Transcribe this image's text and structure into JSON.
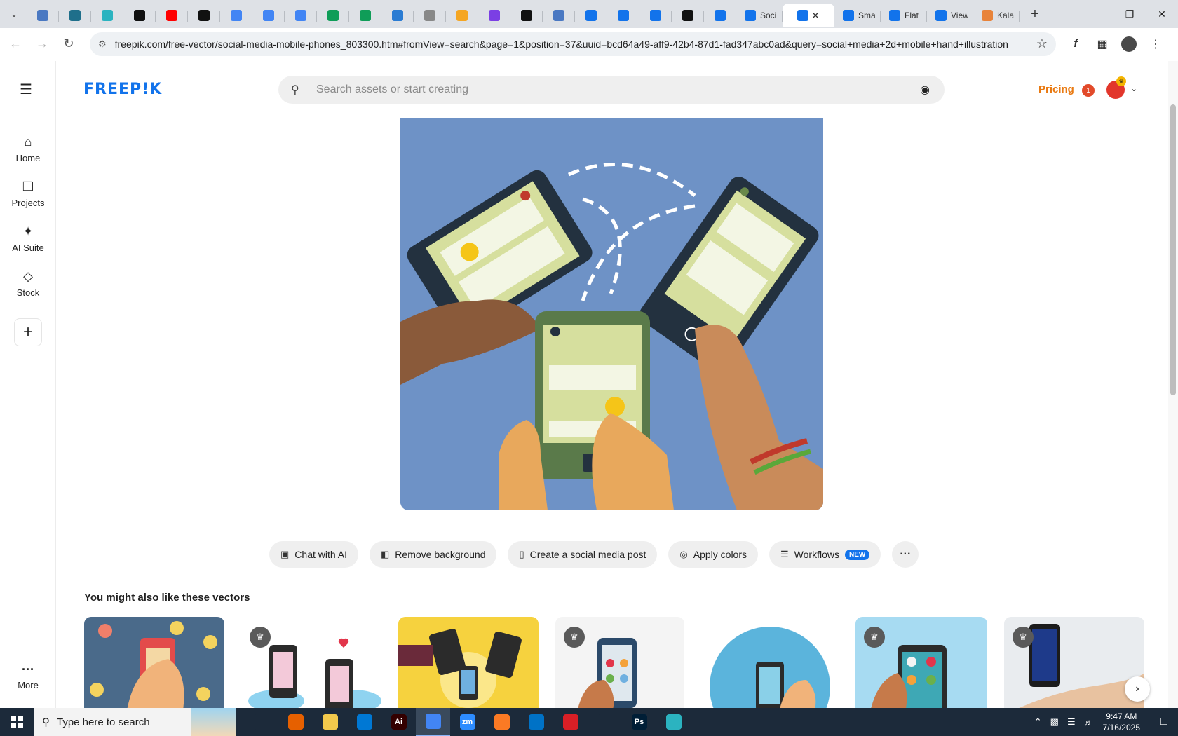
{
  "browser": {
    "tabs": [
      {
        "icon": "globe-icon",
        "color": "#4a78c2",
        "title": ""
      },
      {
        "icon": "vpn-icon",
        "color": "#1f6f8b",
        "title": ""
      },
      {
        "icon": "hex-icon",
        "color": "#2bb3c0",
        "title": ""
      },
      {
        "icon": "openai-icon",
        "color": "#111111",
        "title": ""
      },
      {
        "icon": "youtube-icon",
        "color": "#ff0000",
        "title": ""
      },
      {
        "icon": "bolt-icon",
        "color": "#111111",
        "title": ""
      },
      {
        "icon": "docs-icon",
        "color": "#4285f4",
        "title": ""
      },
      {
        "icon": "docs-icon",
        "color": "#4285f4",
        "title": ""
      },
      {
        "icon": "docs-icon",
        "color": "#4285f4",
        "title": ""
      },
      {
        "icon": "sheets-icon",
        "color": "#0f9d58",
        "title": ""
      },
      {
        "icon": "sheets-icon",
        "color": "#0f9d58",
        "title": ""
      },
      {
        "icon": "word-icon",
        "color": "#2b7cd3",
        "title": ""
      },
      {
        "icon": "globe-icon",
        "color": "#888888",
        "title": ""
      },
      {
        "icon": "wing-icon",
        "color": "#f5a623",
        "title": ""
      },
      {
        "icon": "braces-icon",
        "color": "#7b3fe4",
        "title": ""
      },
      {
        "icon": "logo-a-icon",
        "color": "#111111",
        "title": ""
      },
      {
        "icon": "grid-icon",
        "color": "#4a78c2",
        "title": ""
      },
      {
        "icon": "freepik-doc-icon",
        "color": "#1273eb",
        "title": ""
      },
      {
        "icon": "freepik-doc-icon",
        "color": "#1273eb",
        "title": ""
      },
      {
        "icon": "freepik-doc-icon",
        "color": "#1273eb",
        "title": ""
      },
      {
        "icon": "m-icon",
        "color": "#111111",
        "title": ""
      },
      {
        "icon": "freepik-doc-icon",
        "color": "#1273eb",
        "title": ""
      },
      {
        "icon": "freepik-doc-icon",
        "color": "#1273eb",
        "title": "Soci"
      },
      {
        "icon": "freepik-doc-icon",
        "color": "#1273eb",
        "title": "",
        "active": true
      },
      {
        "icon": "freepik-doc-icon",
        "color": "#1273eb",
        "title": "Sma"
      },
      {
        "icon": "freepik-doc-icon",
        "color": "#1273eb",
        "title": "Flat"
      },
      {
        "icon": "freepik-doc-icon",
        "color": "#1273eb",
        "title": "View"
      },
      {
        "icon": "kala-icon",
        "color": "#e8833a",
        "title": "Kala"
      }
    ],
    "url": "freepik.com/free-vector/social-media-mobile-phones_803300.htm#fromView=search&page=1&position=37&uuid=bcd64a49-aff9-42b4-87d1-fad347abc0ad&query=social+media+2d+mobile+hand+illustration"
  },
  "sidebar": {
    "items": [
      {
        "label": "Home",
        "icon": "home-icon"
      },
      {
        "label": "Projects",
        "icon": "projects-icon"
      },
      {
        "label": "AI Suite",
        "icon": "sparkle-icon"
      },
      {
        "label": "Stock",
        "icon": "shapes-icon"
      }
    ],
    "more_label": "More"
  },
  "header": {
    "logo": "FREEP!K",
    "search_placeholder": "Search assets or start creating",
    "pricing": "Pricing",
    "notification_count": "1"
  },
  "actions": [
    {
      "label": "Chat with AI",
      "icon": "chat-ai-icon"
    },
    {
      "label": "Remove background",
      "icon": "remove-bg-icon"
    },
    {
      "label": "Create a social media post",
      "icon": "phone-icon"
    },
    {
      "label": "Apply colors",
      "icon": "palette-icon"
    },
    {
      "label": "Workflows",
      "icon": "workflow-icon",
      "badge": "NEW"
    }
  ],
  "related": {
    "title": "You might also like these vectors"
  },
  "taskbar": {
    "search_text": "Type here to search",
    "apps": [
      {
        "icon": "task-view-icon",
        "color": "#1c2a3a",
        "label": ""
      },
      {
        "icon": "firefox-icon",
        "color": "#e66000",
        "label": ""
      },
      {
        "icon": "file-explorer-icon",
        "color": "#f2c94c",
        "label": ""
      },
      {
        "icon": "vscode-icon",
        "color": "#0078d4",
        "label": ""
      },
      {
        "icon": "illustrator-icon",
        "color": "#330000",
        "label": "Ai"
      },
      {
        "icon": "chrome-icon",
        "color": "#4285f4",
        "label": "",
        "active": true
      },
      {
        "icon": "zoom-icon",
        "color": "#2d8cff",
        "label": "zm"
      },
      {
        "icon": "xampp-icon",
        "color": "#fb7a24",
        "label": ""
      },
      {
        "icon": "outlook-icon",
        "color": "#0072c6",
        "label": ""
      },
      {
        "icon": "creative-cloud-icon",
        "color": "#da1f26",
        "label": ""
      },
      {
        "icon": "pen-icon",
        "color": "#1c2a3a",
        "label": ""
      },
      {
        "icon": "photoshop-icon",
        "color": "#001e36",
        "label": "Ps"
      },
      {
        "icon": "gem-icon",
        "color": "#2bb3c0",
        "label": ""
      }
    ],
    "time": "9:47 AM",
    "date": "7/16/2025"
  }
}
